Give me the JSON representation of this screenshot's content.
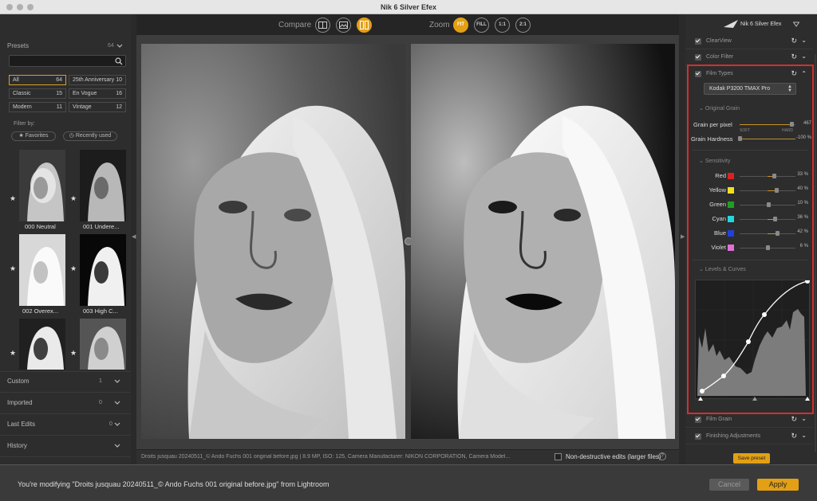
{
  "window": {
    "title": "Nik 6 Silver Efex"
  },
  "presets": {
    "title": "Presets",
    "count": "64",
    "search_placeholder": "",
    "categories": [
      {
        "label": "All",
        "count": "64"
      },
      {
        "label": "25th Anniversary",
        "count": "10"
      },
      {
        "label": "Classic",
        "count": "15"
      },
      {
        "label": "En Vogue",
        "count": "16"
      },
      {
        "label": "Modern",
        "count": "11"
      },
      {
        "label": "Vintage",
        "count": "12"
      }
    ],
    "filter_label": "Filter by:",
    "filters": {
      "favorites": "Favorites",
      "recent": "Recently used"
    },
    "thumbnails": [
      {
        "label": "000 Neutral"
      },
      {
        "label": "001 Undere..."
      },
      {
        "label": "002 Overex..."
      },
      {
        "label": "003 High C..."
      },
      {
        "label": ""
      },
      {
        "label": ""
      }
    ],
    "groups": [
      {
        "label": "Custom",
        "count": "1"
      },
      {
        "label": "Imported",
        "count": "0"
      },
      {
        "label": "Last Edits",
        "count": "0"
      },
      {
        "label": "History",
        "count": ""
      }
    ]
  },
  "toolbar": {
    "compare_label": "Compare",
    "zoom_label": "Zoom",
    "zoom_options": [
      "FIT",
      "FILL",
      "1:1",
      "2:1"
    ],
    "zoom_selected": "FIT"
  },
  "status": {
    "file_info": "Droits jusquau 20240511_© Ando Fuchs 001 original before.jpg  |  8.9 MP, ISO: 125, Camera Manufacturer: NIKON CORPORATION, Camera Model...",
    "nondestructive_label": "Non-destructive edits (larger files)",
    "help": "?"
  },
  "panel": {
    "title": "Nik 6 Silver Efex",
    "sections": {
      "clearview": "ClearView",
      "color_filter": "Color Filter",
      "film_types": "Film Types",
      "film_grain": "Film Grain",
      "finishing": "Finishing Adjustments"
    },
    "film_type_selected": "Kodak P3200 TMAX Pro",
    "original_grain": {
      "title": "Original Grain",
      "grain_per_pixel": {
        "label": "Grain per pixel",
        "value": "467",
        "fraction": 0.93
      },
      "soft_label": "SOFT",
      "hard_label": "HARD",
      "grain_hardness": {
        "label": "Grain Hardness",
        "value": "-100 %",
        "fraction": 0.0
      }
    },
    "sensitivity": {
      "title": "Sensitivity",
      "channels": [
        {
          "label": "Red",
          "value": "33 %",
          "color": "#e02020",
          "fraction": 0.62
        },
        {
          "label": "Yellow",
          "value": "40 %",
          "color": "#f0e020",
          "fraction": 0.66
        },
        {
          "label": "Green",
          "value": "10 %",
          "color": "#20a020",
          "fraction": 0.52
        },
        {
          "label": "Cyan",
          "value": "36 %",
          "color": "#20d8e0",
          "fraction": 0.63
        },
        {
          "label": "Blue",
          "value": "42 %",
          "color": "#2040e0",
          "fraction": 0.67
        },
        {
          "label": "Violet",
          "value": "6 %",
          "color": "#e070d8",
          "fraction": 0.5
        }
      ]
    },
    "levels_title": "Levels & Curves",
    "save_preset": "Save preset"
  },
  "footer": {
    "message": "You're modifying \"Droits jusquau 20240511_© Ando Fuchs 001 original before.jpg\" from Lightroom",
    "cancel": "Cancel",
    "apply": "Apply"
  },
  "colors": {
    "accent": "#e3a014",
    "highlight_border": "#d42f2f"
  }
}
